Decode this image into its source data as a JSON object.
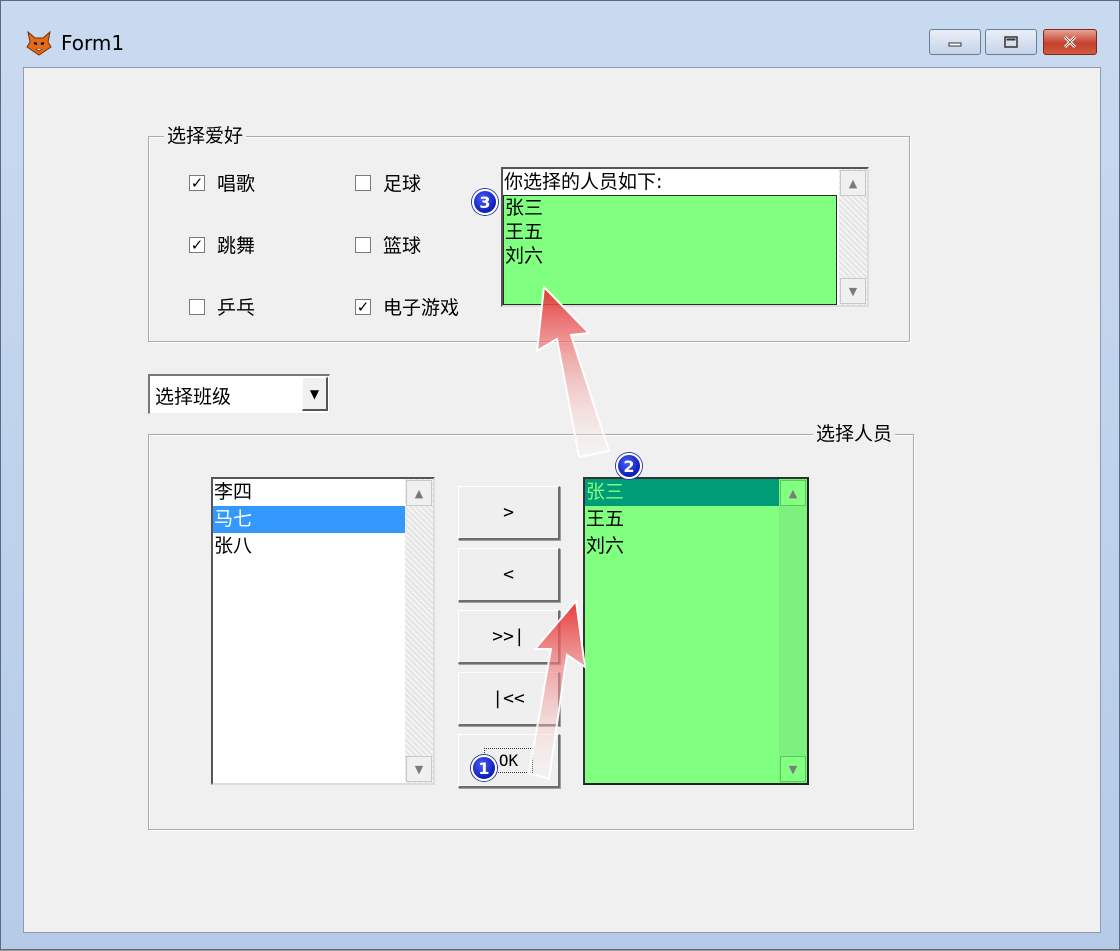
{
  "window": {
    "title": "Form1"
  },
  "hobbies": {
    "legend": "选择爱好",
    "checkboxes": [
      {
        "label": "唱歌",
        "checked": true
      },
      {
        "label": "足球",
        "checked": false
      },
      {
        "label": "跳舞",
        "checked": true
      },
      {
        "label": "篮球",
        "checked": false
      },
      {
        "label": "乒乓",
        "checked": false
      },
      {
        "label": "电子游戏",
        "checked": true
      }
    ],
    "result_list": {
      "header": "你选择的人员如下:",
      "items": [
        "张三",
        "王五",
        "刘六"
      ]
    }
  },
  "class_combo": {
    "selected": "选择班级"
  },
  "people": {
    "legend": "选择人员",
    "available_list": {
      "items": [
        "李四",
        "马七",
        "张八"
      ],
      "selected_index": 1
    },
    "buttons": {
      "move_right": ">",
      "move_left": "<",
      "move_all_right": ">>|",
      "move_all_left": "|<<",
      "ok": "OK"
    },
    "selected_list": {
      "items": [
        "张三",
        "王五",
        "刘六"
      ],
      "selected_index": 0
    }
  },
  "annotations": {
    "badges": [
      "1",
      "2",
      "3"
    ]
  },
  "colors": {
    "highlight_green": "#80ff80",
    "selection_blue": "#3399ff",
    "selection_teal": "#009b77",
    "badge_blue": "#1020c8",
    "arrow_red": "#e53030"
  }
}
